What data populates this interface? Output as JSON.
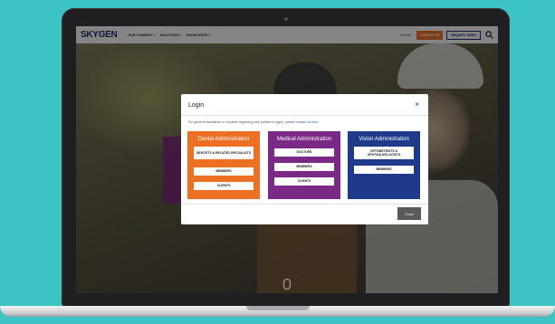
{
  "site": {
    "logo": "SKYGEN",
    "nav": [
      "OUR COMPANY ˅",
      "SOLUTIONS ˅",
      "KNOWLEDGE ˅"
    ],
    "login_link": "LOGIN",
    "contact_button": "CONTACT US",
    "demo_button": "REQUEST DEMO",
    "search_icon": "search-icon"
  },
  "modal": {
    "title": "Login",
    "close_icon": "×",
    "note_prefix": "For general assistance or inquiries regarding web portals or logins, please ",
    "note_link": "contact us here",
    "note_suffix": ".",
    "panels": [
      {
        "title": "Dental Administration",
        "color": "#ec6f23",
        "buttons": [
          "DENTISTS & RELATED SPECIALISTS",
          "MEMBERS",
          "CLIENTS"
        ]
      },
      {
        "title": "Medical Administration",
        "color": "#7a2a86",
        "buttons": [
          "DOCTORS",
          "MEMBERS",
          "CLIENTS"
        ]
      },
      {
        "title": "Vision Administration",
        "color": "#1f3a8a",
        "buttons": [
          "OPTOMETRISTS & OPHTHALMOLOGISTS",
          "MEMBERS"
        ]
      }
    ],
    "close_button": "Close"
  },
  "colors": {
    "background": "#3cc3c4",
    "brand_navy": "#1a2d6b",
    "brand_orange": "#e8702a"
  }
}
